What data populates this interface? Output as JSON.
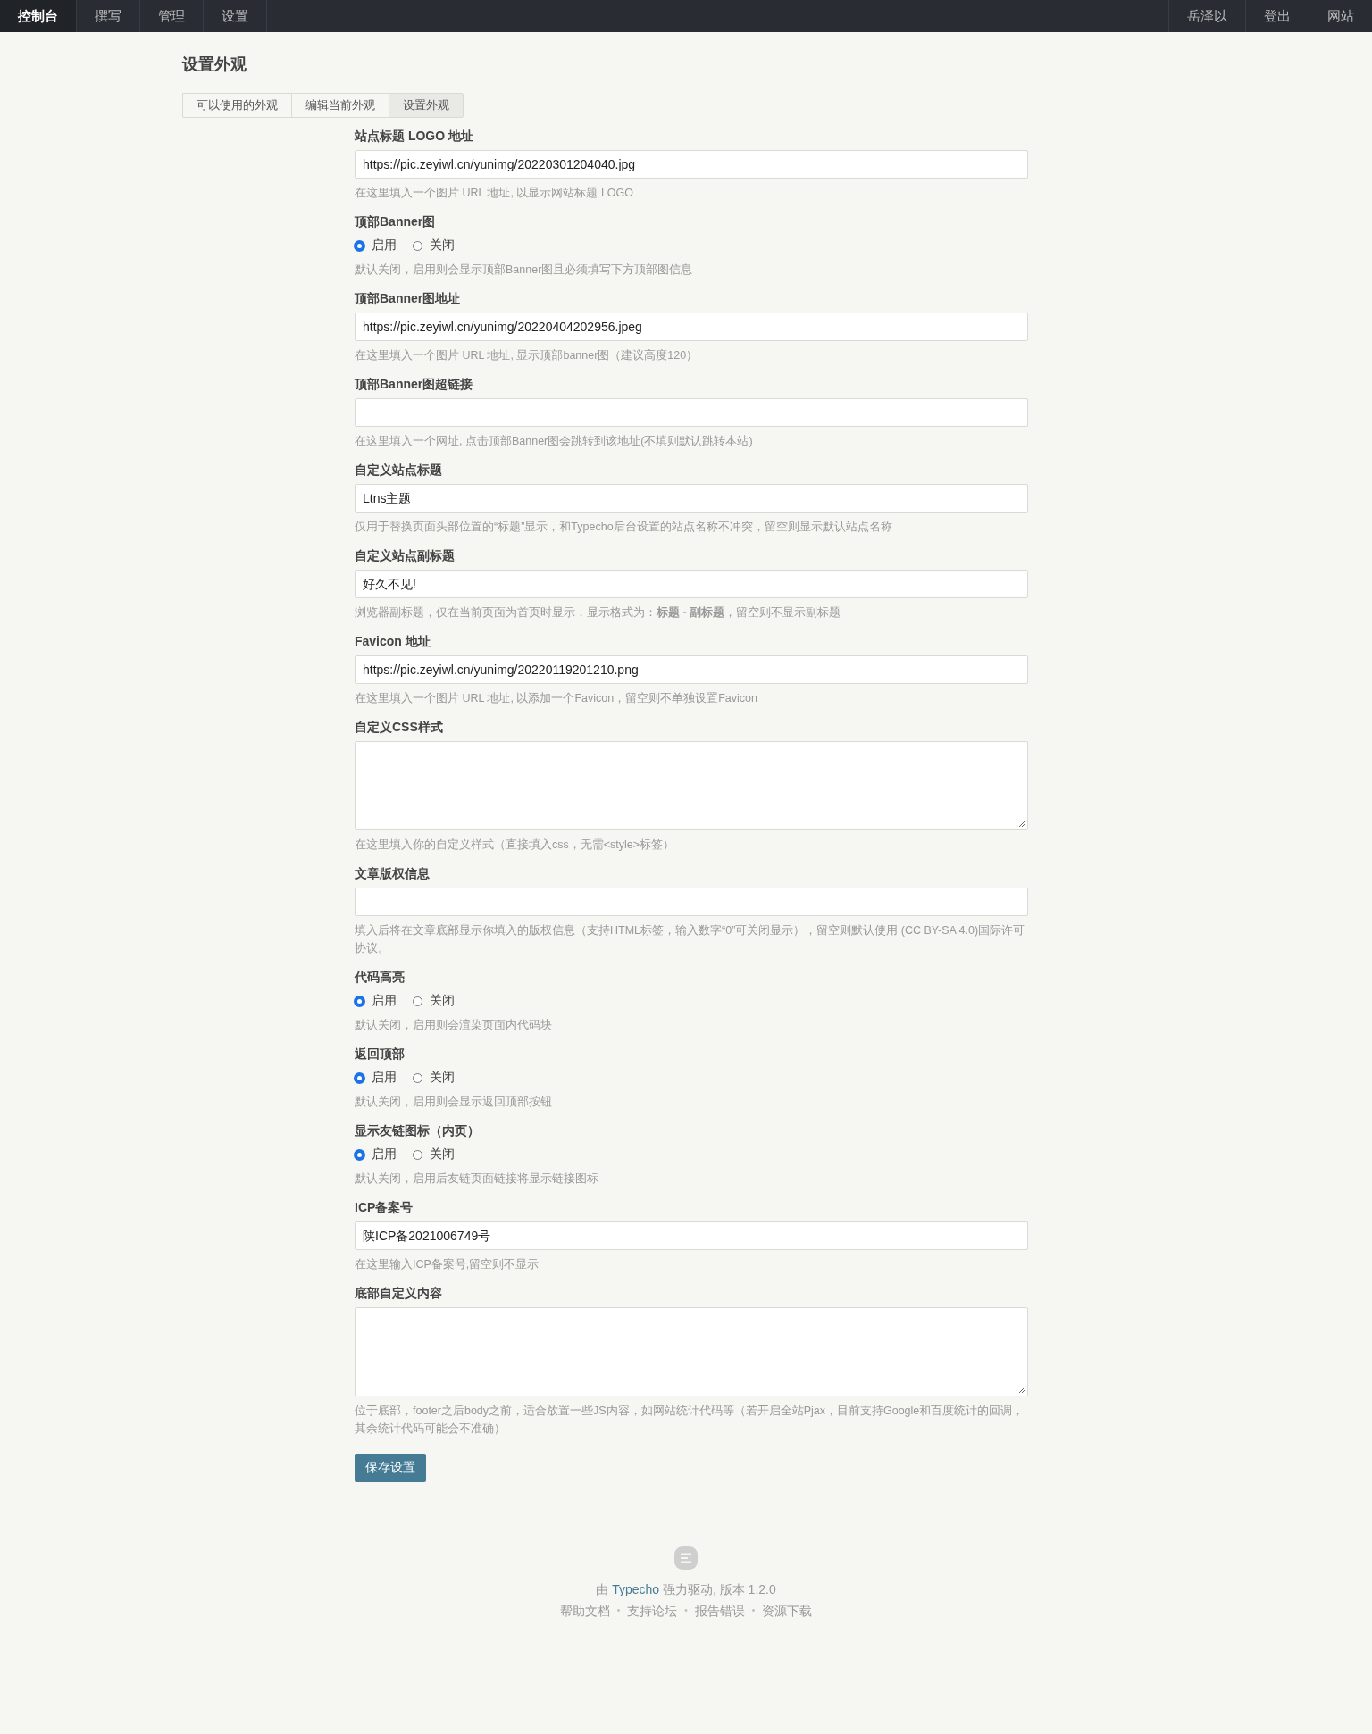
{
  "nav": {
    "left": [
      {
        "label": "控制台",
        "selected": true
      },
      {
        "label": "撰写",
        "selected": false
      },
      {
        "label": "管理",
        "selected": false
      },
      {
        "label": "设置",
        "selected": false
      }
    ],
    "right": [
      "岳泽以",
      "登出",
      "网站"
    ]
  },
  "page_title": "设置外观",
  "tabs": [
    {
      "label": "可以使用的外观",
      "selected": false
    },
    {
      "label": "编辑当前外观",
      "selected": false
    },
    {
      "label": "设置外观",
      "selected": true
    }
  ],
  "fields": [
    {
      "kind": "text",
      "label": "站点标题 LOGO 地址",
      "value": "https://pic.zeyiwl.cn/yunimg/20220301204040.jpg",
      "hint": "在这里填入一个图片 URL 地址, 以显示网站标题 LOGO"
    },
    {
      "kind": "radio",
      "label": "顶部Banner图",
      "options": [
        {
          "label": "启用",
          "selected": true
        },
        {
          "label": "关闭",
          "selected": false
        }
      ],
      "hint": "默认关闭，启用则会显示顶部Banner图且必须填写下方顶部图信息"
    },
    {
      "kind": "text",
      "label": "顶部Banner图地址",
      "value": "https://pic.zeyiwl.cn/yunimg/20220404202956.jpeg",
      "hint": "在这里填入一个图片 URL 地址, 显示顶部banner图（建议高度120）"
    },
    {
      "kind": "text",
      "label": "顶部Banner图超链接",
      "hint": "在这里填入一个网址, 点击顶部Banner图会跳转到该地址(不填则默认跳转本站)"
    },
    {
      "kind": "text",
      "label": "自定义站点标题",
      "value": "Ltns主题",
      "hint": "仅用于替换页面头部位置的“标题”显示，和Typecho后台设置的站点名称不冲突，留空则显示默认站点名称"
    },
    {
      "kind": "text",
      "label": "自定义站点副标题",
      "value": "好久不见!",
      "hint": "浏览器副标题，仅在当前页面为首页时显示，显示格式为：**标题 - 副标题**，留空则不显示副标题"
    },
    {
      "kind": "text",
      "label": "Favicon 地址",
      "value": "https://pic.zeyiwl.cn/yunimg/20220119201210.png",
      "hint": "在这里填入一个图片 URL 地址, 以添加一个Favicon，留空则不单独设置Favicon"
    },
    {
      "kind": "textarea",
      "label": "自定义CSS样式",
      "hint": "在这里填入你的自定义样式（直接填入css，无需<style>标签）"
    },
    {
      "kind": "text",
      "label": "文章版权信息",
      "hint": "填入后将在文章底部显示你填入的版权信息（支持HTML标签，输入数字“0”可关闭显示），留空则默认使用 (CC BY-SA 4.0)国际许可协议。"
    },
    {
      "kind": "radio",
      "label": "代码高亮",
      "options": [
        {
          "label": "启用",
          "selected": true
        },
        {
          "label": "关闭",
          "selected": false
        }
      ],
      "hint": "默认关闭，启用则会渲染页面内代码块"
    },
    {
      "kind": "radio",
      "label": "返回顶部",
      "options": [
        {
          "label": "启用",
          "selected": true
        },
        {
          "label": "关闭",
          "selected": false
        }
      ],
      "hint": "默认关闭，启用则会显示返回顶部按钮"
    },
    {
      "kind": "radio",
      "label": "显示友链图标（内页）",
      "options": [
        {
          "label": "启用",
          "selected": true
        },
        {
          "label": "关闭",
          "selected": false
        }
      ],
      "hint": "默认关闭，启用后友链页面链接将显示链接图标"
    },
    {
      "kind": "text",
      "label": "ICP备案号",
      "value": "陕ICP备2021006749号",
      "hint": "在这里输入ICP备案号,留空则不显示"
    },
    {
      "kind": "textarea",
      "label": "底部自定义内容",
      "hint": "位于底部，footer之后body之前，适合放置一些JS内容，如网站统计代码等（若开启全站Pjax，目前支持Google和百度统计的回调，其余统计代码可能会不准确）"
    }
  ],
  "save_button": "保存设置",
  "footer": {
    "prefix": "由",
    "link": "Typecho",
    "suffix": "强力驱动, 版本 1.2.0",
    "separator": "•",
    "links": [
      "帮助文档",
      "支持论坛",
      "报告错误",
      "资源下载"
    ]
  }
}
